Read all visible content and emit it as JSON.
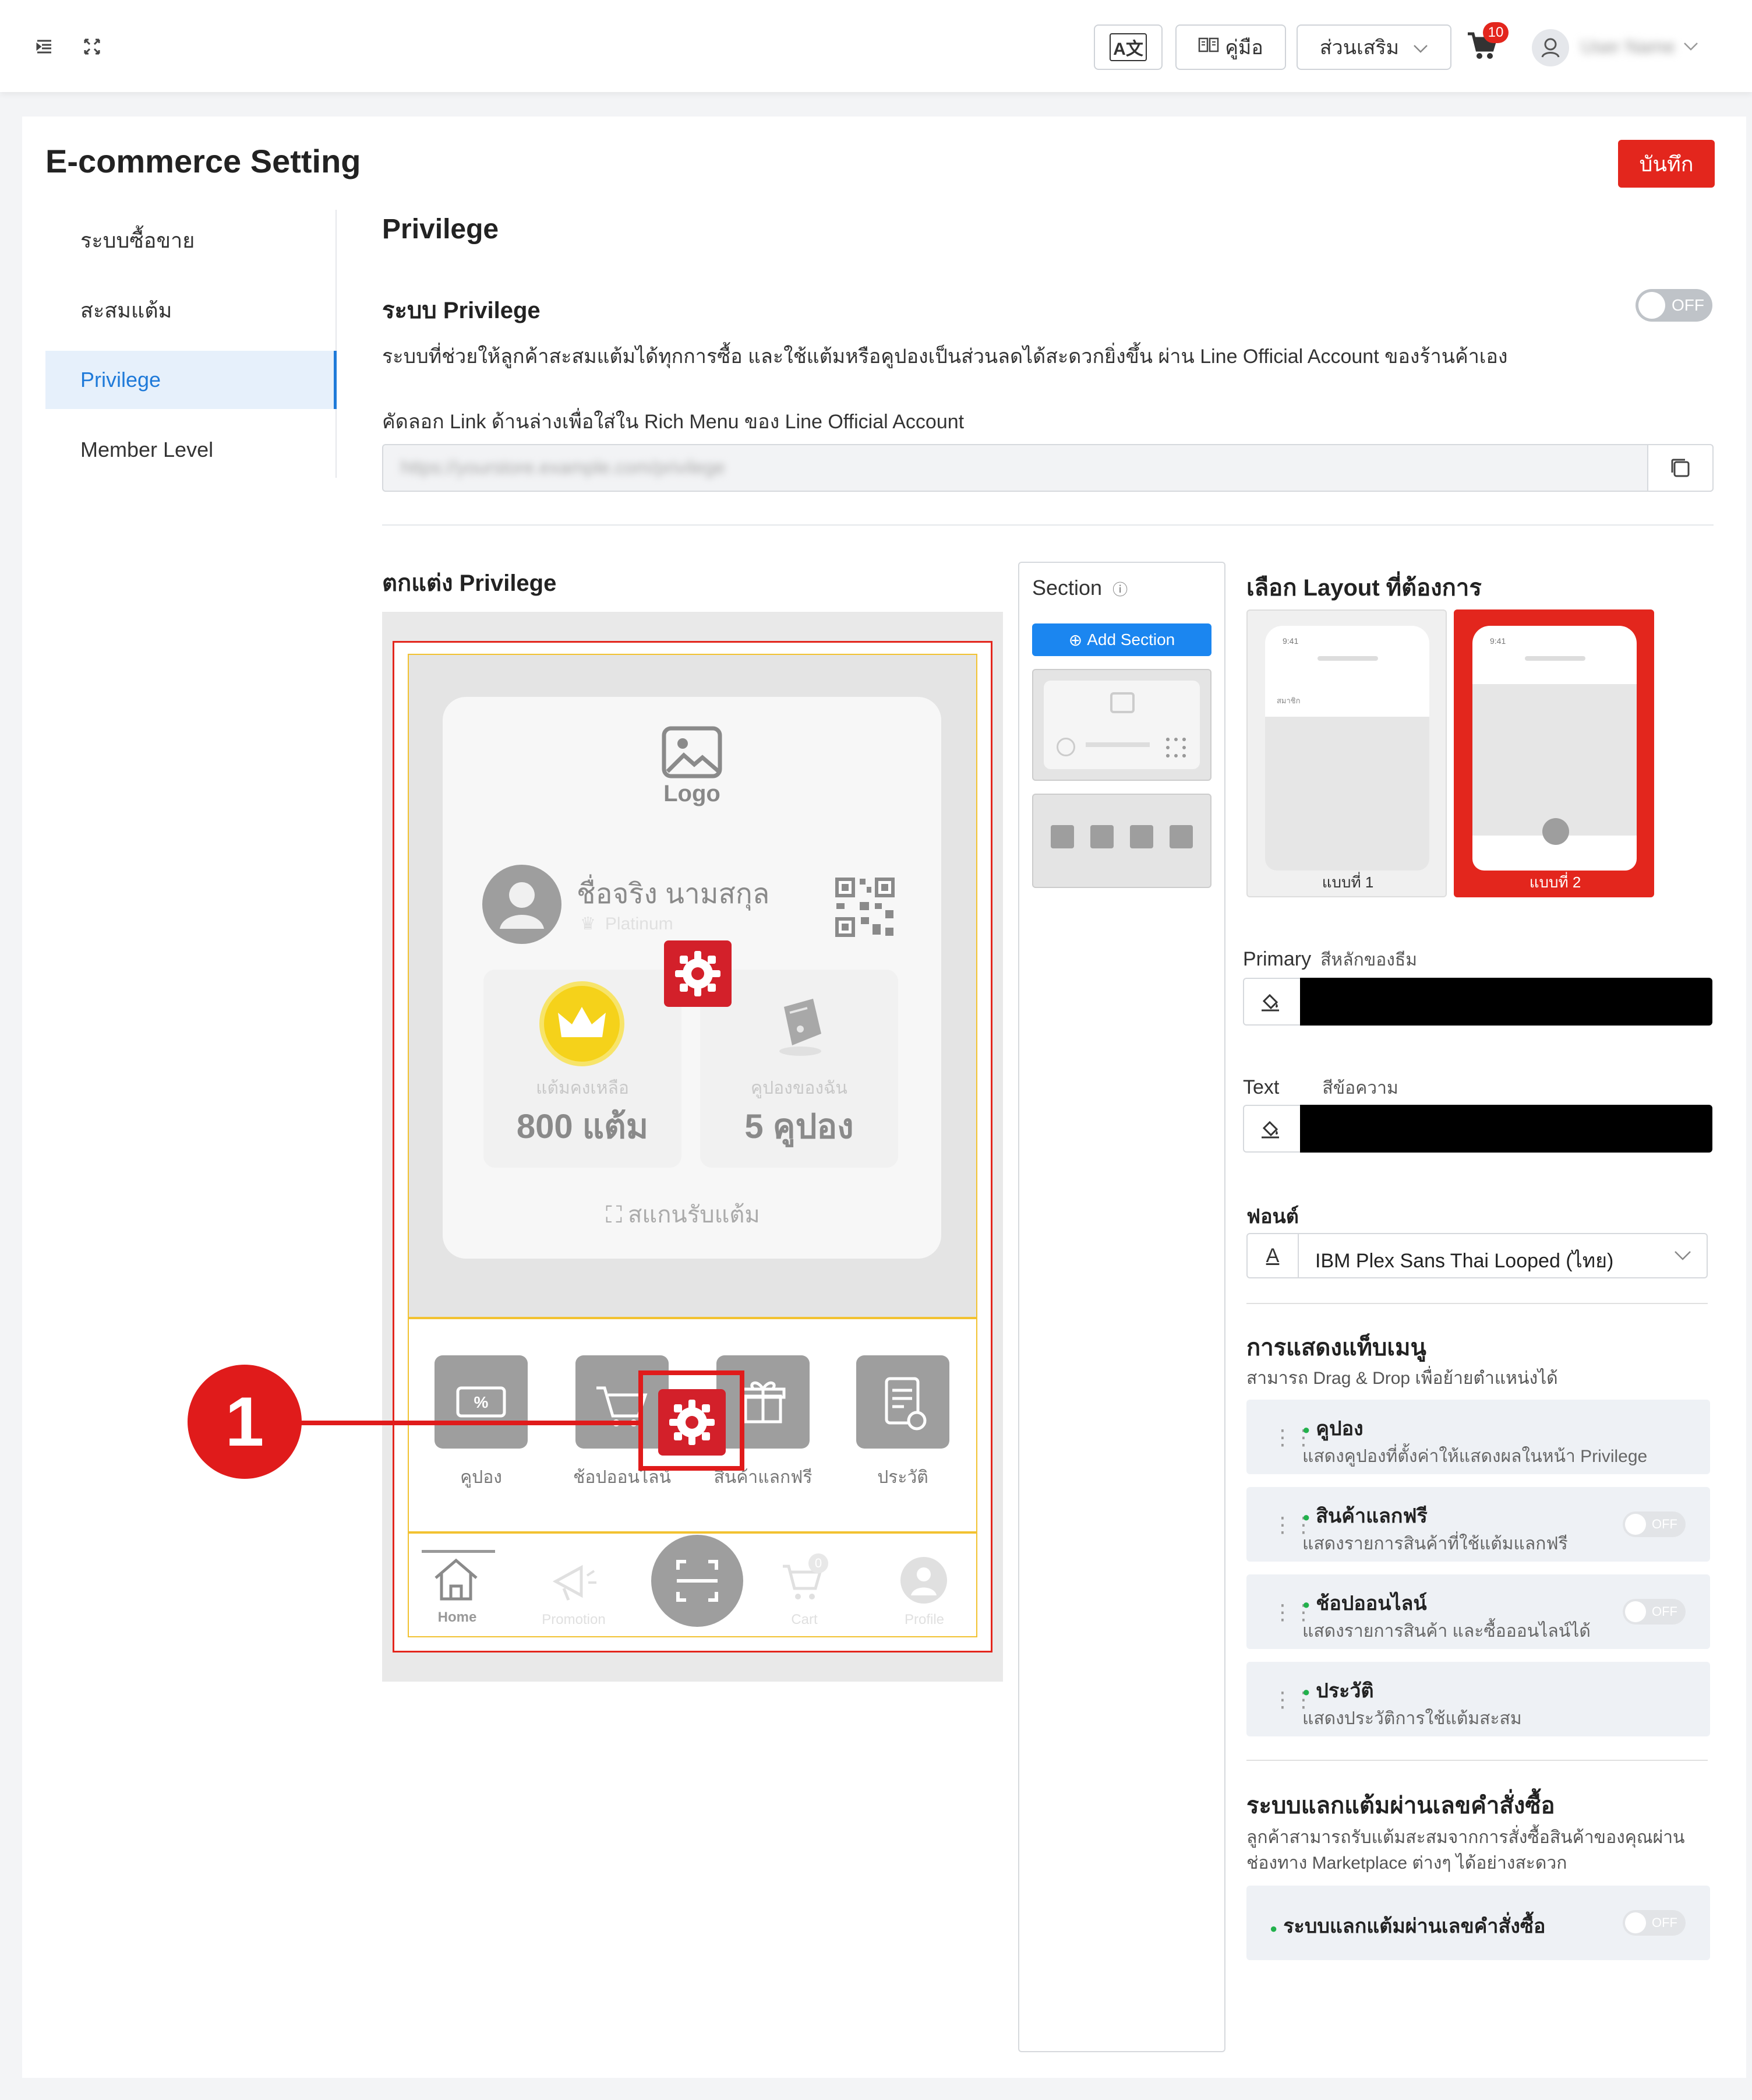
{
  "topbar": {
    "lang_label": "A文",
    "manual_label": "คู่มือ",
    "addons_label": "ส่วนเสริม",
    "cart_count": "10",
    "user_name": "User Name"
  },
  "page": {
    "title": "E-commerce Setting",
    "save_label": "บันทึก"
  },
  "sidebar": {
    "items": [
      {
        "label": "ระบบซื้อขาย",
        "active": false
      },
      {
        "label": "สะสมแต้ม",
        "active": false
      },
      {
        "label": "Privilege",
        "active": true
      },
      {
        "label": "Member Level",
        "active": false
      }
    ]
  },
  "privilege": {
    "heading": "Privilege",
    "system_title": "ระบบ Privilege",
    "system_toggle": "OFF",
    "system_desc": "ระบบที่ช่วยให้ลูกค้าสะสมแต้มได้ทุกการซื้อ และใช้แต้มหรือคูปองเป็นส่วนลดได้สะดวกยิ่งขึ้น ผ่าน Line Official Account ของร้านค้าเอง",
    "copy_label": "คัดลอก Link ด้านล่างเพื่อใส่ใน Rich Menu ของ Line Official Account",
    "link_value": "https://yourstore.example.com/privilege"
  },
  "customize": {
    "title": "ตกแต่ง Privilege",
    "preview": {
      "logo_text": "Logo",
      "member_name": "ชื่อจริง นามสกุล",
      "tier": "Platinum",
      "points_label": "แต้มคงเหลือ",
      "points_value": "800 แต้ม",
      "coupons_label": "คูปองของฉัน",
      "coupons_value": "5 คูปอง",
      "scan_label": "สแกนรับแต้ม",
      "menu_tiles": [
        "คูปอง",
        "ช้อปออนไลน์",
        "สินค้าแลกฟรี",
        "ประวัติ"
      ],
      "nav": [
        "Home",
        "Promotion",
        "Cart",
        "Profile"
      ],
      "cart_badge": "0"
    },
    "annotation_number": "1"
  },
  "section_panel": {
    "title": "Section",
    "add_label": "Add Section"
  },
  "layout": {
    "title": "เลือก Layout ที่ต้องการ",
    "options": [
      {
        "label": "แบบที่ 1",
        "selected": false
      },
      {
        "label": "แบบที่ 2",
        "selected": true
      }
    ],
    "mock_time": "9:41",
    "mock_tab": "สมาชิก"
  },
  "colors": {
    "primary_label": "Primary",
    "primary_desc": "สีหลักของธีม",
    "primary_value": "#000000",
    "text_label": "Text",
    "text_desc": "สีข้อความ",
    "text_value": "#000000"
  },
  "font": {
    "title": "ฟอนต์",
    "icon_letter": "A",
    "value": "IBM Plex Sans Thai Looped (ไทย)"
  },
  "tab_menu": {
    "title": "การแสดงแท็บเมนู",
    "desc": "สามารถ Drag & Drop เพื่อย้ายตำแหน่งได้",
    "items": [
      {
        "title": "คูปอง",
        "desc": "แสดงคูปองที่ตั้งค่าให้แสดงผลในหน้า Privilege",
        "toggle": ""
      },
      {
        "title": "สินค้าแลกฟรี",
        "desc": "แสดงรายการสินค้าที่ใช้แต้มแลกฟรี",
        "toggle": "OFF"
      },
      {
        "title": "ช้อปออนไลน์",
        "desc": "แสดงรายการสินค้า และซื้อออนไลน์ได้",
        "toggle": "OFF"
      },
      {
        "title": "ประวัติ",
        "desc": "แสดงประวัติการใช้แต้มสะสม",
        "toggle": ""
      }
    ]
  },
  "order_points": {
    "title": "ระบบแลกแต้มผ่านเลขคำสั่งซื้อ",
    "desc1": "ลูกค้าสามารถรับแต้มสะสมจากการสั่งซื้อสินค้าของคุณผ่าน",
    "desc2": "ช่องทาง Marketplace ต่างๆ ได้อย่างสะดวก",
    "item_label": "ระบบแลกแต้มผ่านเลขคำสั่งซื้อ",
    "toggle": "OFF"
  },
  "accent": {
    "brand_red": "#e3261d",
    "link_blue": "#1f7ad9",
    "button_blue": "#1b86f0",
    "annotation_red": "#e01b1b",
    "gold": "#f5c518"
  }
}
